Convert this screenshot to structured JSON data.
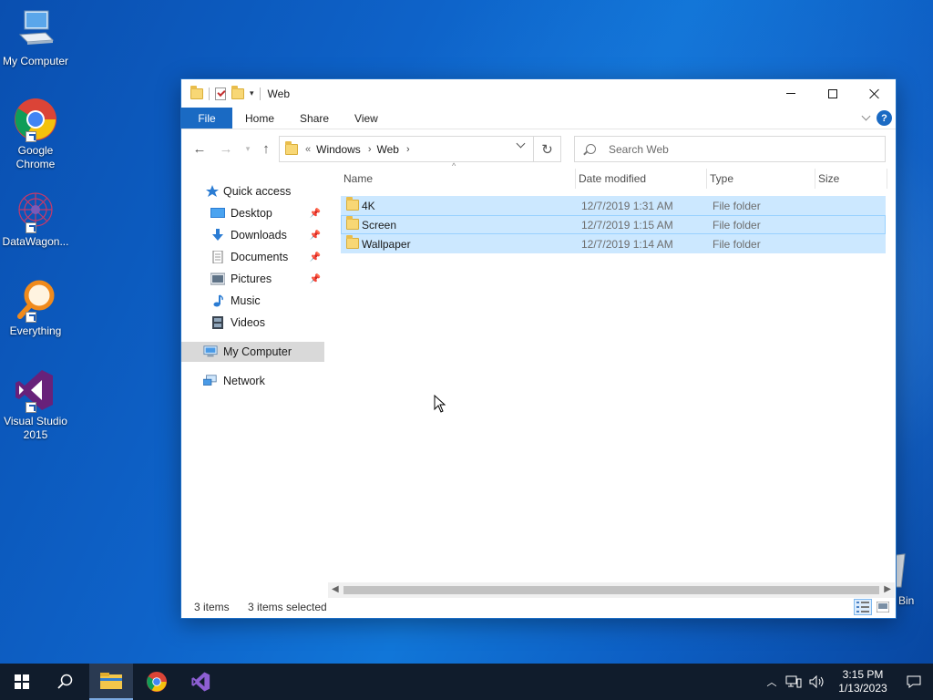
{
  "desktop": {
    "icons": [
      {
        "label": "My Computer",
        "icon": "computer-icon"
      },
      {
        "label": "Google Chrome",
        "icon": "chrome-icon"
      },
      {
        "label": "DataWagon...",
        "icon": "datawagon-icon"
      },
      {
        "label": "Everything",
        "icon": "everything-search-icon"
      },
      {
        "label": "Visual Studio 2015",
        "icon": "visual-studio-icon"
      }
    ],
    "recycle_bin_partial_label": "Bin"
  },
  "window": {
    "title": "Web",
    "ribbon_tabs": [
      "File",
      "Home",
      "Share",
      "View"
    ],
    "help_glyph": "?",
    "address": {
      "lead": "«",
      "crumbs": [
        "Windows",
        "Web"
      ]
    },
    "search_placeholder": "Search Web",
    "nav_pane": {
      "quick_access": "Quick access",
      "pinned": [
        "Desktop",
        "Downloads",
        "Documents",
        "Pictures"
      ],
      "unpinned": [
        "Music",
        "Videos"
      ],
      "my_computer": "My Computer",
      "network": "Network"
    },
    "columns": [
      "Name",
      "Date modified",
      "Type",
      "Size"
    ],
    "rows": [
      {
        "name": "4K",
        "date": "12/7/2019 1:31 AM",
        "type": "File folder",
        "size": ""
      },
      {
        "name": "Screen",
        "date": "12/7/2019 1:15 AM",
        "type": "File folder",
        "size": ""
      },
      {
        "name": "Wallpaper",
        "date": "12/7/2019 1:14 AM",
        "type": "File folder",
        "size": ""
      }
    ],
    "status": {
      "count": "3 items",
      "selected": "3 items selected"
    }
  },
  "taskbar": {
    "clock_time": "3:15 PM",
    "clock_date": "1/13/2023"
  },
  "colors": {
    "accent": "#1a6ac3",
    "selection": "#cce8ff",
    "folder": "#f8d775",
    "taskbar": "#101c2c"
  }
}
